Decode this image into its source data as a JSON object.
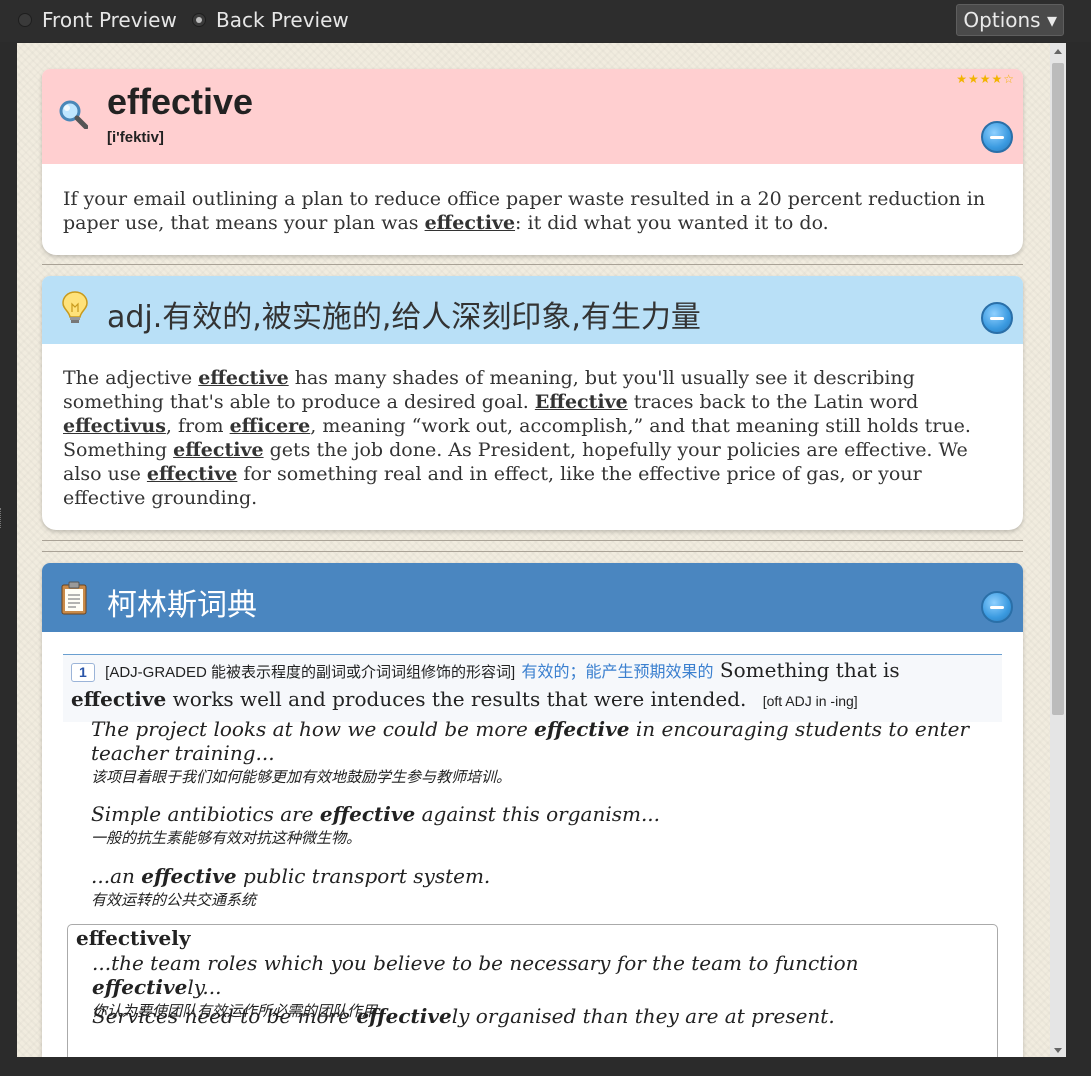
{
  "topbar": {
    "front_preview": "Front Preview",
    "back_preview": "Back Preview",
    "selected": "back_preview",
    "options": "Options ▾"
  },
  "card_header": {
    "word": "effective",
    "phonetic": "[i'fektiv]",
    "rating_stars": "★★★★☆",
    "icon": "magnifier-icon"
  },
  "summary": {
    "before": "If your email outlining a plan to reduce office paper waste resulted in a 20 percent reduction in paper use, that means your plan was ",
    "keyword": "effective",
    "after": ": it did what you wanted it to do."
  },
  "definition": {
    "icon": "lightbulb-icon",
    "title": "adj.有效的,被实施的,给人深刻印象,有生力量",
    "p1": "The adjective ",
    "k1": "effective",
    "p2": " has many shades of meaning, but you'll usually see it describing something that's able to produce a desired goal. ",
    "k2": "Effective",
    "p3": " traces back to the Latin word ",
    "k3": "effectivus",
    "p4": ", from ",
    "k4": "efficere",
    "p5": ", meaning “work out, accomplish,” and that meaning still holds true. Something ",
    "k5": "effective",
    "p6": " gets the job done. As President, hopefully your policies are effective. We also use ",
    "k6": "effective",
    "p7": " for something real and in effect, like the effective price of gas, or your effective grounding."
  },
  "collins": {
    "icon": "clipboard-icon",
    "title": "柯林斯词典",
    "sense": {
      "number": "1",
      "grammar": "[ADJ-GRADED 能被表示程度的副词或介词词组修饰的形容词]",
      "cn": "有效的；能产生预期效果的",
      "en_before": " Something that is ",
      "en_keyword": "effective",
      "en_after": " works well and produces the results that were intended.",
      "note": "[oft ADJ in -ing]"
    },
    "examples": [
      {
        "en_before": "The project looks at how we could be more ",
        "en_keyword": "effective",
        "en_after": " in encouraging students to enter teacher training...",
        "cn": "该项目着眼于我们如何能够更加有效地鼓励学生参与教师培训。"
      },
      {
        "en_before": "Simple antibiotics are ",
        "en_keyword": "effective",
        "en_after": " against this organism...",
        "cn": "一般的抗生素能够有效对抗这种微生物。"
      },
      {
        "en_before": "...an ",
        "en_keyword": "effective",
        "en_after": " public transport system.",
        "cn": "有效运转的公共交通系统"
      }
    ],
    "derived": {
      "word": "effectively",
      "examples": [
        {
          "en_before": "...the team roles which you believe to be necessary for the team to function ",
          "en_keyword": "effective",
          "en_after": "ly...",
          "cn": "你认为要使团队有效运作所必需的团队作用"
        },
        {
          "en_before": "Services need to be more ",
          "en_keyword": "effective",
          "en_after": "ly organised than they are at present.",
          "cn": ""
        }
      ]
    }
  },
  "colors": {
    "word_header": "#ffcfd0",
    "definition_header": "#b9e0f7",
    "collins_header": "#4a86c0",
    "collapse_button": "#3a9ae0"
  }
}
